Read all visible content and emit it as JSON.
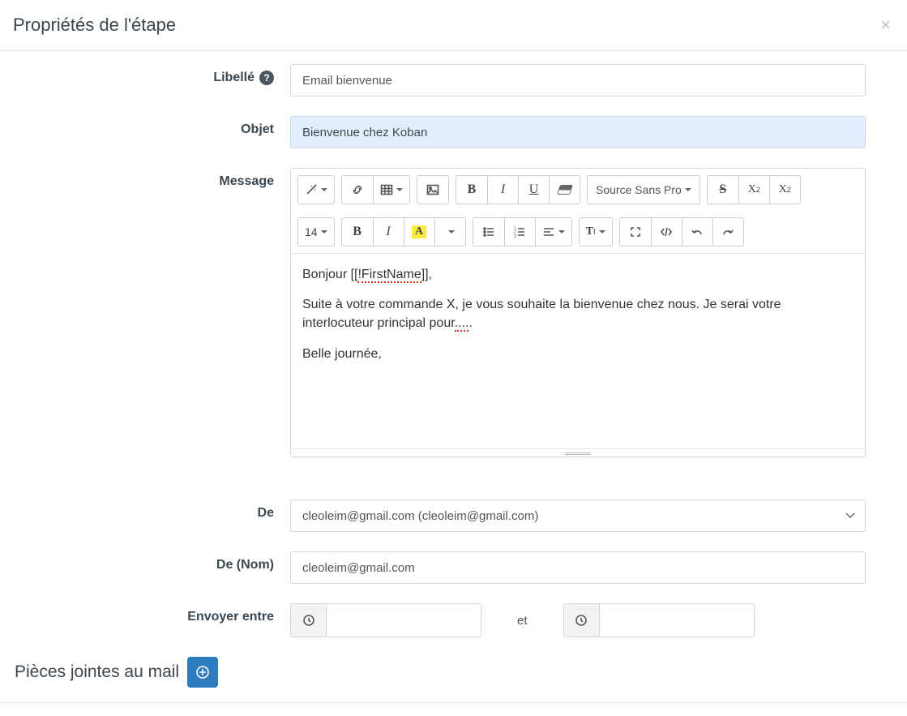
{
  "header": {
    "title": "Propriétés de l'étape"
  },
  "fields": {
    "libelle": {
      "label": "Libellé",
      "value": "Email bienvenue"
    },
    "objet": {
      "label": "Objet",
      "value": "Bienvenue chez Koban"
    },
    "message": {
      "label": "Message"
    },
    "de": {
      "label": "De",
      "selected": "cleoleim@gmail.com (cleoleim@gmail.com)"
    },
    "de_nom": {
      "label": "De (Nom)",
      "value": "cleoleim@gmail.com"
    },
    "envoyer": {
      "label": "Envoyer entre",
      "between_word": "et",
      "start": "",
      "end": ""
    }
  },
  "editor": {
    "font_name": "Source Sans Pro",
    "font_size": "14",
    "body": {
      "greeting_pre": "Bonjour [[",
      "greeting_token": "!FirstName",
      "greeting_post": "]],",
      "p2_pre": "Suite à votre commande X, je vous souhaite la bienvenue chez nous. Je serai votre interlocuteur principal pour",
      "p2_token": "....",
      "p2_post": ".",
      "p3": "Belle journée,"
    }
  },
  "attachments": {
    "label": "Pièces jointes au mail"
  }
}
